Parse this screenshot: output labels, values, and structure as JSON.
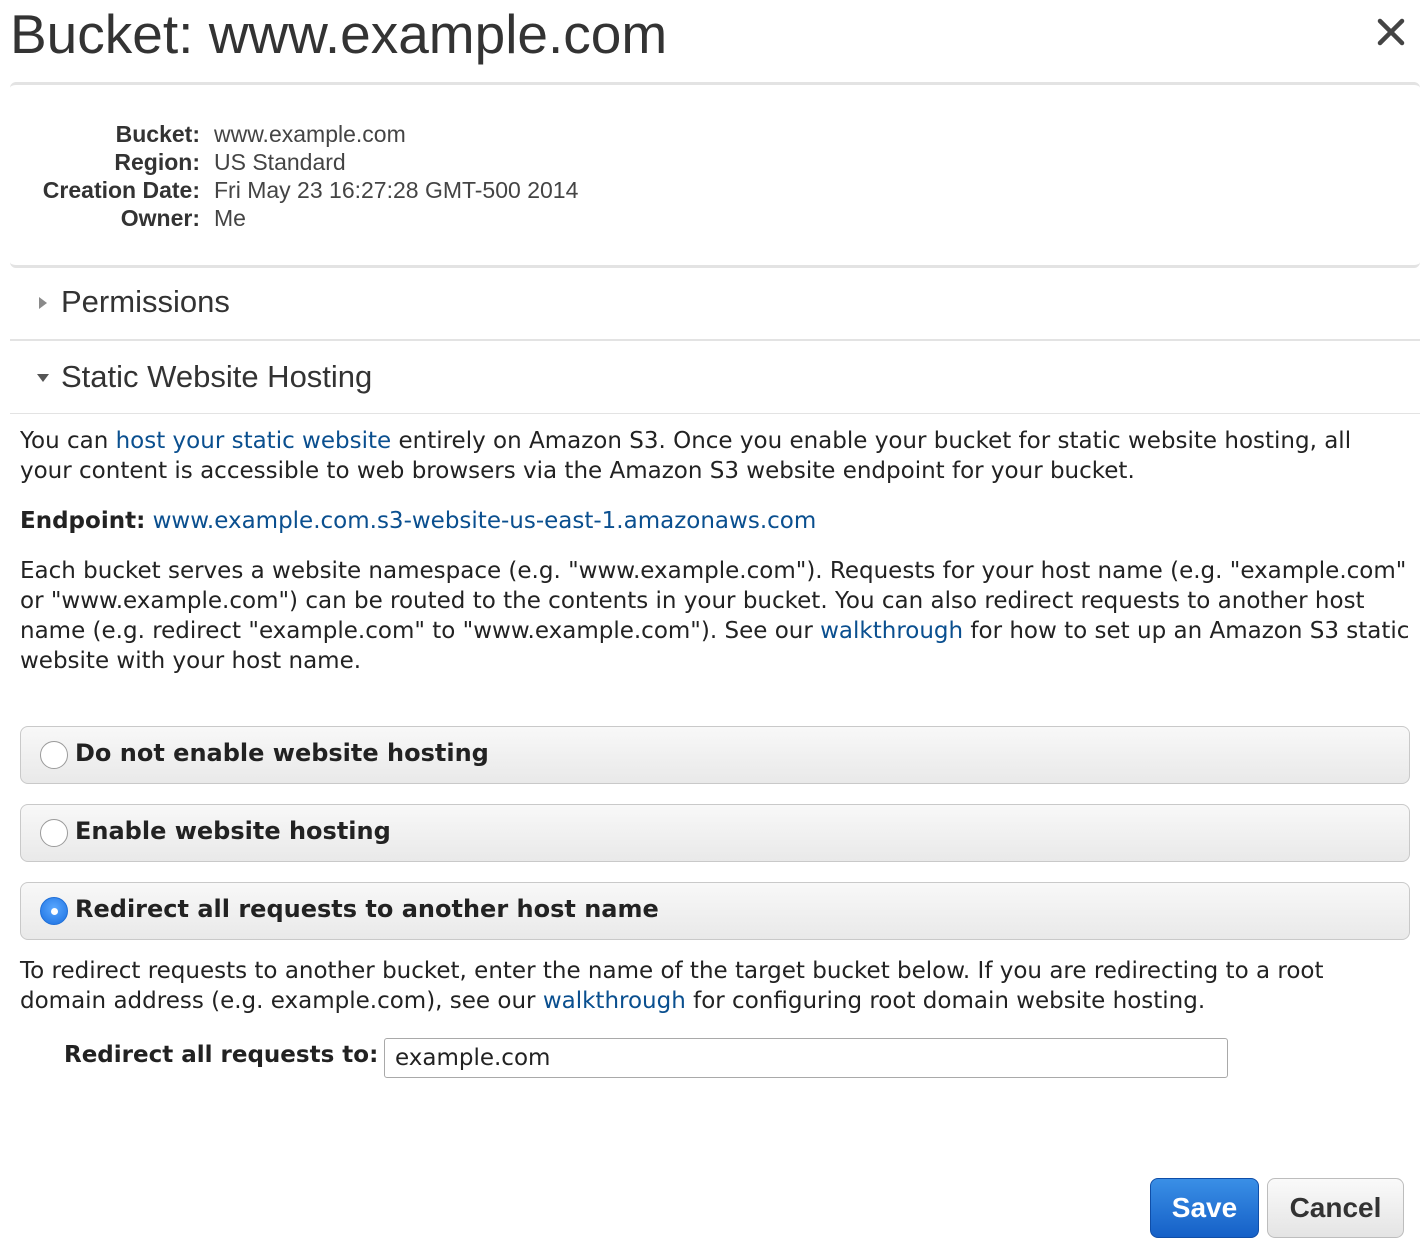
{
  "header": {
    "title": "Bucket: www.example.com",
    "close_icon": "close-icon"
  },
  "properties": {
    "rows": [
      {
        "label": "Bucket:",
        "value": "www.example.com"
      },
      {
        "label": "Region:",
        "value": "US Standard"
      },
      {
        "label": "Creation Date:",
        "value": "Fri May 23 16:27:28 GMT-500 2014"
      },
      {
        "label": "Owner:",
        "value": "Me"
      }
    ]
  },
  "sections": {
    "permissions": {
      "label": "Permissions",
      "expanded": false
    },
    "static_hosting": {
      "label": "Static Website Hosting",
      "expanded": true
    }
  },
  "hosting": {
    "intro": {
      "before": "You can ",
      "link": "host your static website",
      "after": " entirely on Amazon S3. Once you enable your bucket for static website hosting, all your content is accessible to web browsers via the Amazon S3 website endpoint for your bucket."
    },
    "endpoint_label": "Endpoint:",
    "endpoint_value": "www.example.com.s3-website-us-east-1.amazonaws.com",
    "namespace_text": {
      "before": "Each bucket serves a website namespace (e.g. \"www.example.com\"). Requests for your host name (e.g. \"example.com\" or \"www.example.com\") can be routed to the contents in your bucket. You can also redirect requests to another host name (e.g. redirect \"example.com\" to \"www.example.com\"). See our ",
      "link": "walkthrough",
      "after": " for how to set up an Amazon S3 static website with your host name."
    },
    "options": [
      {
        "label": "Do not enable website hosting",
        "checked": false
      },
      {
        "label": "Enable website hosting",
        "checked": false
      },
      {
        "label": "Redirect all requests to another host name",
        "checked": true
      }
    ],
    "redirect_text": {
      "before": "To redirect requests to another bucket, enter the name of the target bucket below. If you are redirecting to a root domain address (e.g. example.com), see our ",
      "link": "walkthrough",
      "after": " for configuring root domain website hosting."
    },
    "redirect_label": "Redirect all requests to:",
    "redirect_value": "example.com"
  },
  "footer": {
    "save_label": "Save",
    "cancel_label": "Cancel"
  },
  "colors": {
    "link": "#0a4f8f",
    "save_button": "#1560c7",
    "radio_selected": "#1a6fe0"
  }
}
